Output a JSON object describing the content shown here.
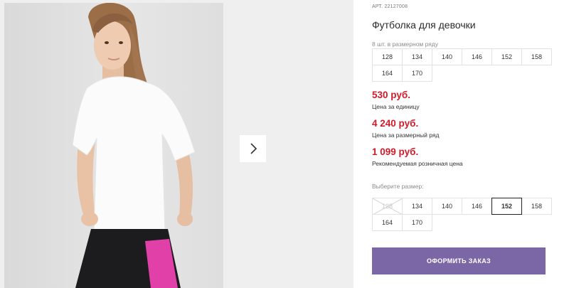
{
  "product": {
    "sku_label": "АРТ.",
    "sku": "22127008",
    "title": "Футболка для девочки"
  },
  "size_range": {
    "caption": "8 шт. в размерном ряду",
    "sizes": [
      "128",
      "134",
      "140",
      "146",
      "152",
      "158",
      "164",
      "170"
    ]
  },
  "prices": [
    {
      "value": "530 руб.",
      "label": "Цена за единицу"
    },
    {
      "value": "4 240 руб.",
      "label": "Цена за размерный ряд"
    },
    {
      "value": "1 099 руб.",
      "label": "Рекомендуемая розничная цена"
    }
  ],
  "size_select": {
    "caption": "Выберите размер:",
    "options": [
      {
        "label": "128",
        "state": "disabled"
      },
      {
        "label": "134",
        "state": "available"
      },
      {
        "label": "140",
        "state": "available"
      },
      {
        "label": "146",
        "state": "available"
      },
      {
        "label": "152",
        "state": "selected"
      },
      {
        "label": "158",
        "state": "available"
      },
      {
        "label": "164",
        "state": "available"
      },
      {
        "label": "170",
        "state": "available"
      }
    ]
  },
  "order_button": "ОФОРМИТЬ ЗАКАЗ",
  "gallery": {
    "next_icon": "chevron-right-icon"
  },
  "colors": {
    "price": "#d11a2a",
    "button": "#7b67a5"
  }
}
